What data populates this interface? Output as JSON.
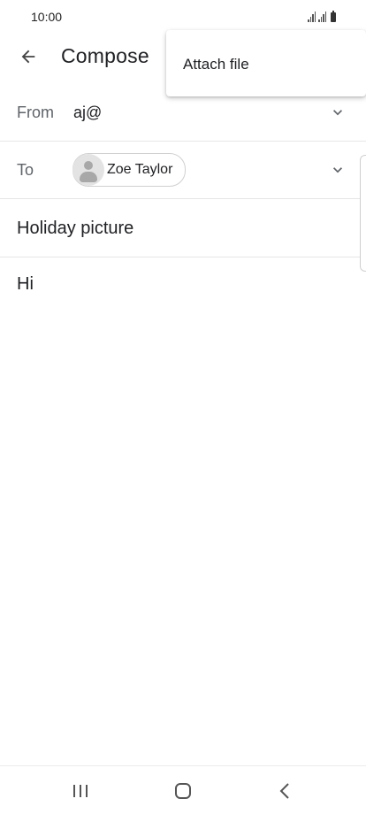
{
  "status_bar": {
    "time": "10:00",
    "icons": [
      "signal-icon",
      "signal-icon",
      "battery-icon"
    ]
  },
  "app_bar": {
    "back_icon": "arrow-left-icon",
    "title": "Compose"
  },
  "overflow_menu": {
    "items": [
      {
        "label": "Attach file"
      }
    ]
  },
  "compose": {
    "from": {
      "label": "From",
      "value": "aj@",
      "icon": "chevron-down-icon"
    },
    "to": {
      "label": "To",
      "recipients": [
        {
          "name": "Zoe Taylor",
          "avatar_icon": "person-icon"
        }
      ],
      "icon": "chevron-down-icon"
    },
    "subject": "Holiday picture",
    "body": "Hi"
  },
  "nav_bar": {
    "recents_icon": "recents-icon",
    "home_icon": "home-icon",
    "back_icon": "back-chevron-icon"
  },
  "colors": {
    "text": "#202124",
    "label": "#5f6368",
    "divider": "#e6e6e6"
  }
}
